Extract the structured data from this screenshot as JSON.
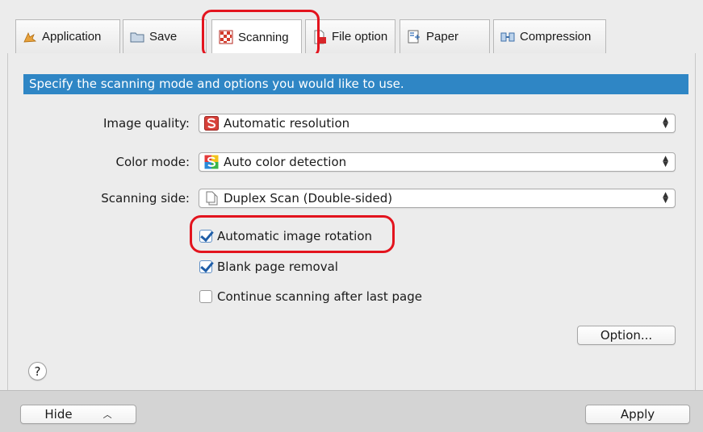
{
  "tabs": [
    {
      "label": "Application",
      "icon": "application-icon"
    },
    {
      "label": "Save",
      "icon": "folder-icon"
    },
    {
      "label": "Scanning",
      "icon": "scanning-icon",
      "active": true
    },
    {
      "label": "File option",
      "icon": "file-option-icon"
    },
    {
      "label": "Paper",
      "icon": "paper-icon"
    },
    {
      "label": "Compression",
      "icon": "compression-icon"
    }
  ],
  "banner": {
    "text": "Specify the scanning mode and options you would like to use."
  },
  "image_quality": {
    "label": "Image quality:",
    "value": "Automatic resolution"
  },
  "color_mode": {
    "label": "Color mode:",
    "value": "Auto color detection"
  },
  "scanning_side": {
    "label": "Scanning side:",
    "value": "Duplex Scan (Double-sided)"
  },
  "options": {
    "auto_rotation": {
      "label": "Automatic image rotation",
      "checked": true
    },
    "blank_removal": {
      "label": "Blank page removal",
      "checked": true
    },
    "continue_scanning": {
      "label": "Continue scanning after last page",
      "checked": false
    }
  },
  "option_button": {
    "label": "Option..."
  },
  "help": {
    "label": "?"
  },
  "footer": {
    "hide_label": "Hide",
    "apply_label": "Apply"
  },
  "colors": {
    "banner": "#2f86c5",
    "highlight": "#e3141e",
    "check": "#1f5ea8"
  }
}
